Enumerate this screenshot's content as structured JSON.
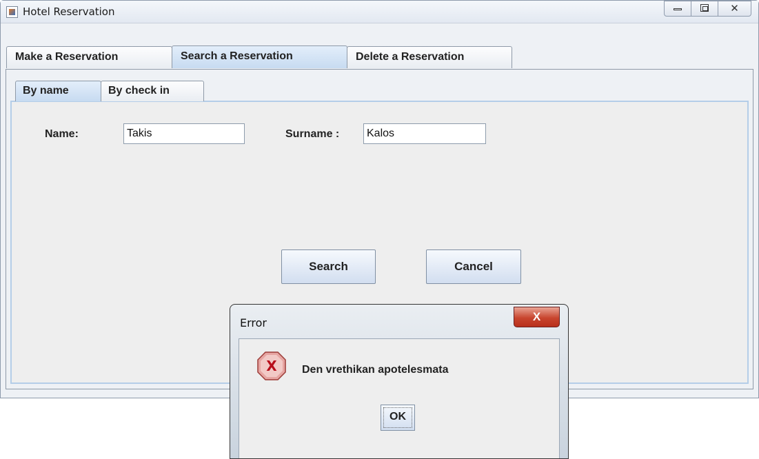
{
  "window": {
    "title": "Hotel Reservation",
    "controls": {
      "minimize": "minimize",
      "maximize": "maximize",
      "close": "close"
    }
  },
  "tabs": [
    {
      "label": "Make a Reservation",
      "selected": false
    },
    {
      "label": "Search a Reservation",
      "selected": true
    },
    {
      "label": "Delete a Reservation",
      "selected": false
    }
  ],
  "subtabs": [
    {
      "label": "By name",
      "selected": true
    },
    {
      "label": "By check in",
      "selected": false
    }
  ],
  "form": {
    "name_label": "Name:",
    "name_value": "Takis",
    "surname_label": "Surname :",
    "surname_value": "Kalos",
    "search_label": "Search",
    "cancel_label": "Cancel"
  },
  "dialog": {
    "title": "Error",
    "close_glyph": "X",
    "icon": "error-icon",
    "message": "Den vrethikan apotelesmata",
    "ok_label": "OK"
  },
  "colors": {
    "selected_tab": "#c7dbf1",
    "error_icon": "#d9534f",
    "close_button": "#c8452e"
  }
}
